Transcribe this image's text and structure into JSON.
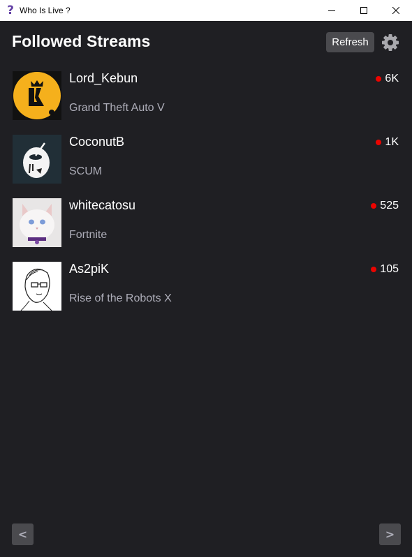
{
  "window": {
    "title": "Who Is Live ?",
    "app_icon_glyph": "?",
    "controls": [
      "minimize-icon",
      "maximize-icon",
      "close-icon"
    ]
  },
  "header": {
    "title": "Followed Streams",
    "refresh_label": "Refresh",
    "settings_icon": "gear-icon"
  },
  "streams": [
    {
      "name": "Lord_Kebun",
      "game": "Grand Theft Auto V",
      "viewers": "6K",
      "avatar": "yellow-lk-logo"
    },
    {
      "name": "CoconutB",
      "game": "SCUM",
      "viewers": "1K",
      "avatar": "coconut-drawing"
    },
    {
      "name": "whitecatosu",
      "game": "Fortnite",
      "viewers": "525",
      "avatar": "white-cat-photo"
    },
    {
      "name": "As2piK",
      "game": "Rise of the Robots X",
      "viewers": "105",
      "avatar": "sketch-face"
    }
  ],
  "pagination": {
    "prev_label": "<",
    "next_label": ">"
  },
  "colors": {
    "background": "#1f1f23",
    "live": "#eb0400",
    "button": "#4a4a4e",
    "muted_text": "#adadb8"
  }
}
